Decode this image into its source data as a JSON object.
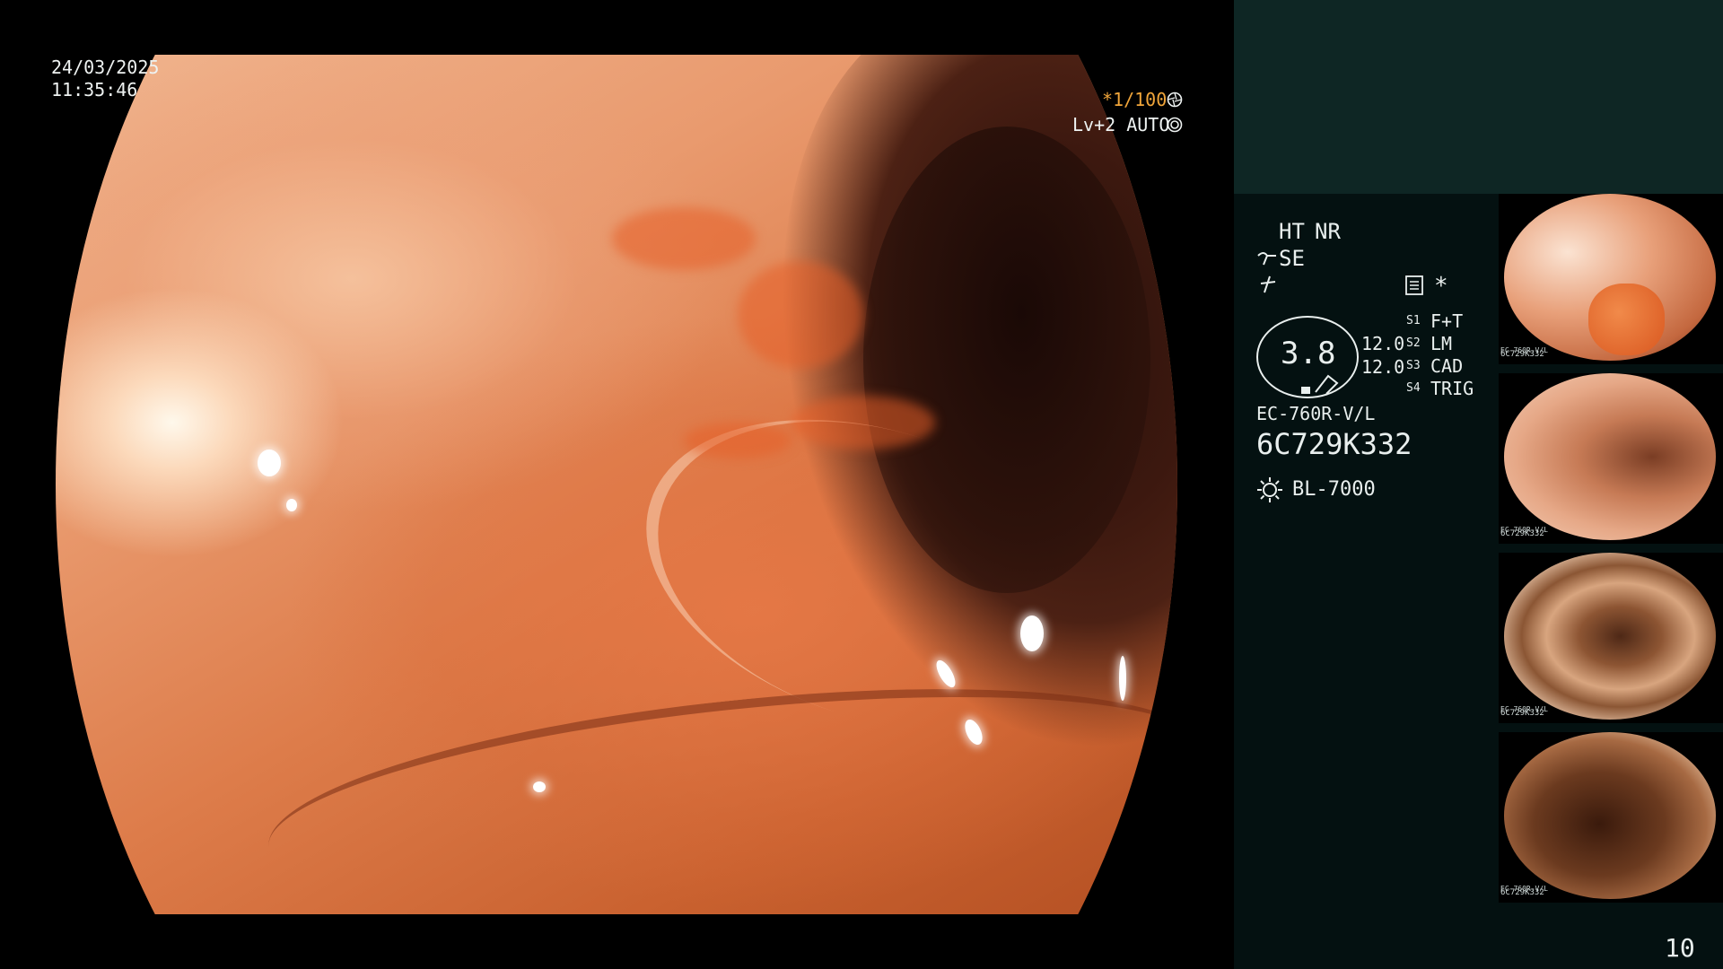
{
  "overlay": {
    "date": "24/03/2025",
    "time": "11:35:46",
    "shutter": "*1/100",
    "shutter_icon": "aperture-icon",
    "level": "Lv+2 AUTO",
    "level_icon": "iris-icon"
  },
  "processor": {
    "ht": "HT",
    "nr": "NR",
    "se": "SE",
    "se_icon": "enhance-icon",
    "freeze_icon": "freeze-icon",
    "memory_icon": "memory-card-icon",
    "star": "*",
    "dial_value": "3.8",
    "values": [
      "12.0",
      "12.0"
    ],
    "switches": [
      {
        "key": "S1",
        "label": "F+T"
      },
      {
        "key": "S2",
        "label": "LM"
      },
      {
        "key": "S3",
        "label": "CAD"
      },
      {
        "key": "S4",
        "label": "TRIG"
      }
    ],
    "scope_model": "EC-760R-V/L",
    "serial": "6C729K332",
    "light_icon": "light-source-icon",
    "light_source": "BL-7000"
  },
  "thumbnails": [
    {
      "id": "6C729K332",
      "info": "EC-760R-V/L",
      "scene": "polyp"
    },
    {
      "id": "6C729K332",
      "info": "EC-760R-V/L",
      "scene": "fold"
    },
    {
      "id": "6C729K332",
      "info": "EC-760R-V/L",
      "scene": "lumen"
    },
    {
      "id": "6C729K332",
      "info": "EC-760R-V/L",
      "scene": "lumen-dark"
    }
  ],
  "image_count": "10",
  "colors": {
    "accent_orange": "#f0a53a",
    "panel_top": "#0e2624",
    "panel": "#041111"
  }
}
